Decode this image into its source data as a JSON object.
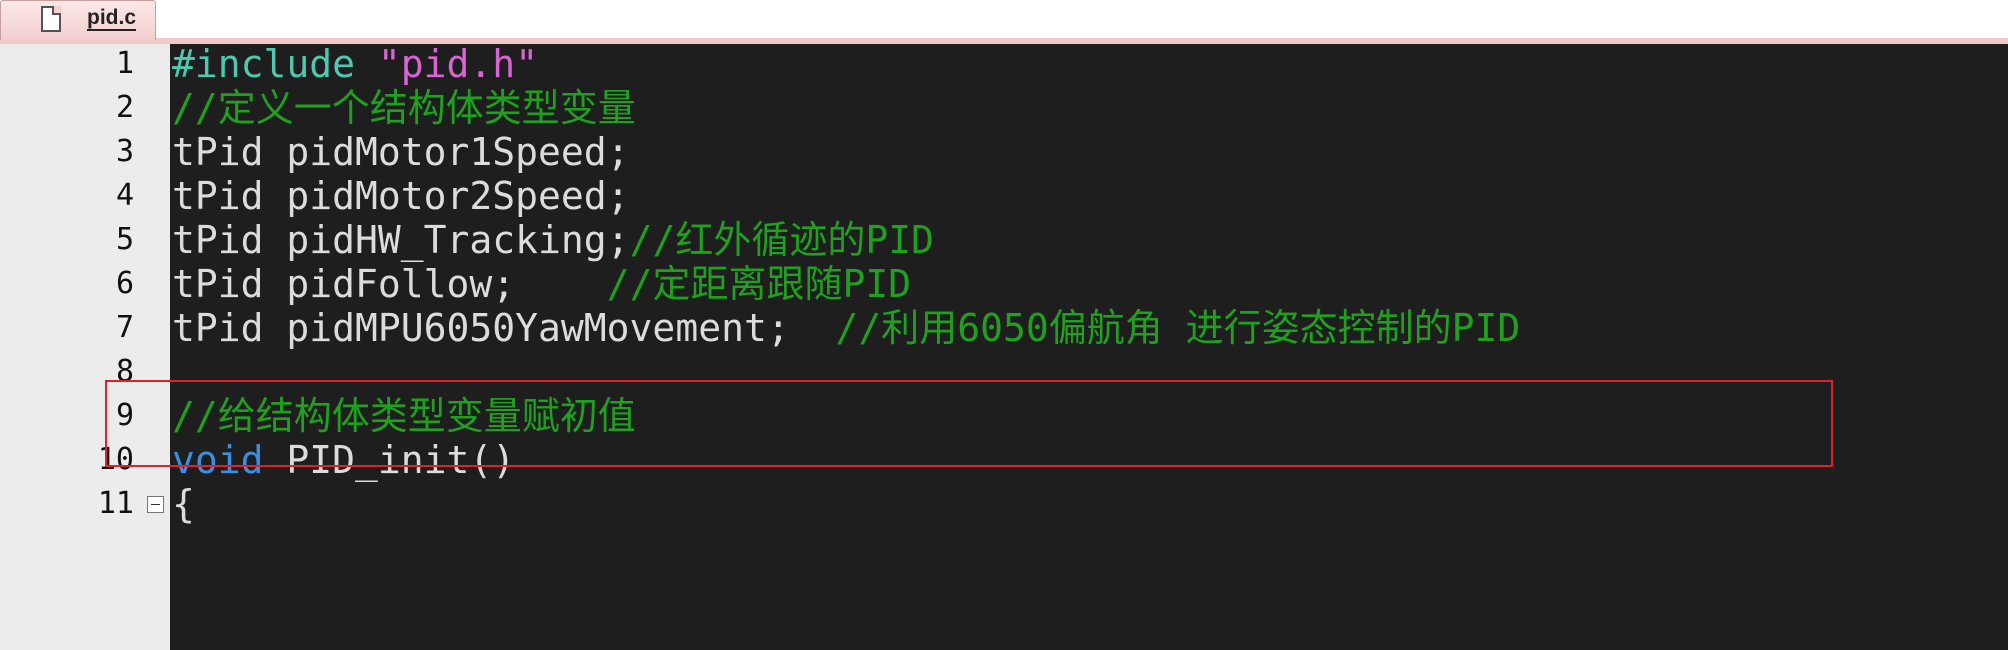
{
  "tab": {
    "label": "pid.c",
    "icon": "file-icon"
  },
  "colors": {
    "preprocessor": "#4ec9b0",
    "string": "#d865d2",
    "comment": "#1fa01f",
    "keyword": "#3a8fe0",
    "text": "#dcdcdc",
    "highlight": "#e0202a"
  },
  "line_numbers": [
    "1",
    "2",
    "3",
    "4",
    "5",
    "6",
    "7",
    "8",
    "9",
    "10",
    "11"
  ],
  "code": {
    "l1": {
      "directive": "#include",
      "space": " ",
      "string": "\"pid.h\""
    },
    "l2": {
      "comment": "//定义一个结构体类型变量"
    },
    "l3": {
      "text": "tPid pidMotor1Speed;"
    },
    "l4": {
      "text": "tPid pidMotor2Speed;"
    },
    "l5": {
      "text": "tPid pidHW_Tracking;",
      "comment": "//红外循迹的PID"
    },
    "l6": {
      "text": "tPid pidFollow;    ",
      "comment": "//定距离跟随PID"
    },
    "l7": {
      "text": "tPid pidMPU6050YawMovement;  ",
      "comment": "//利用6050偏航角 进行姿态控制的PID"
    },
    "l8": {
      "text": ""
    },
    "l9": {
      "comment": "//给结构体类型变量赋初值"
    },
    "l10": {
      "keyword": "void",
      "text": " PID_init()"
    },
    "l11": {
      "text": "{"
    }
  },
  "highlight": {
    "label": "red-box",
    "line": "7"
  }
}
